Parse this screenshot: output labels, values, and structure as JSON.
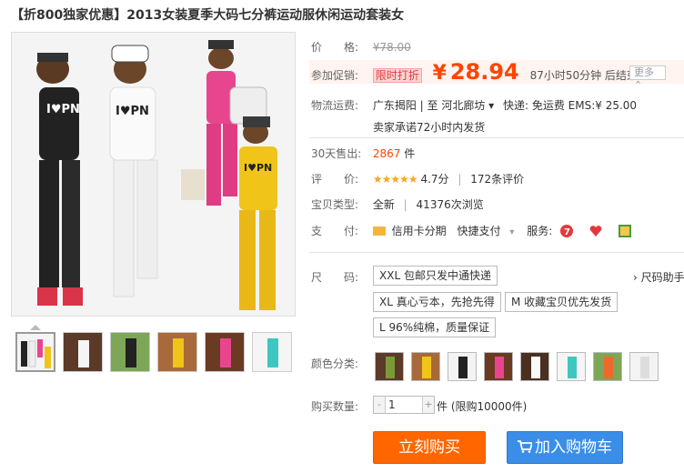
{
  "title": "【折800独家优惠】2013女装夏季大码七分裤运动服休闲运动套装女",
  "price": {
    "label": "价　　格:",
    "original": "¥78.00"
  },
  "promo": {
    "label": "参加促销:",
    "badge": "限时打折",
    "currency": "¥",
    "price": "28.94",
    "countdown": "87小时50分钟 后结束",
    "more": "更多 ⌃"
  },
  "shipping": {
    "label": "物流运费:",
    "route": "广东揭阳 | 至  河北廊坊 ▾",
    "express": "快递: 免运费  EMS:¥ 25.00",
    "promise": "卖家承诺72小时内发货"
  },
  "sales": {
    "label": "30天售出:",
    "count": "2867",
    "unit": "件"
  },
  "rating": {
    "label": "评　　价:",
    "stars": "★★★★★",
    "score": "4.7分",
    "reviews": "172条评价"
  },
  "item_type": {
    "label": "宝贝类型:",
    "condition": "全新",
    "views": "41376次浏览"
  },
  "payment": {
    "label": "支　　付:",
    "credit": "信用卡分期",
    "quick": "快捷支付",
    "dropdown": "▾",
    "service_label": "服务:"
  },
  "size": {
    "label": "尺　　码:",
    "options": [
      "XXL 包邮只发中通快递",
      "XL 真心亏本，先抢先得",
      "M 收藏宝贝优先发货",
      "L 96%纯棉，质量保证"
    ],
    "help": "› 尺码助手"
  },
  "colors": {
    "label": "颜色分类:"
  },
  "quantity": {
    "label": "购买数量:",
    "minus": "-",
    "plus": "+",
    "value": "1",
    "unit_note": "件 (限购10000件)"
  },
  "buttons": {
    "buy": "立刻购买",
    "cart": "加入购物车"
  },
  "colors_hex": {
    "accent": "#ff4400",
    "buy": "#ff6600",
    "cart": "#3b8ee8"
  }
}
